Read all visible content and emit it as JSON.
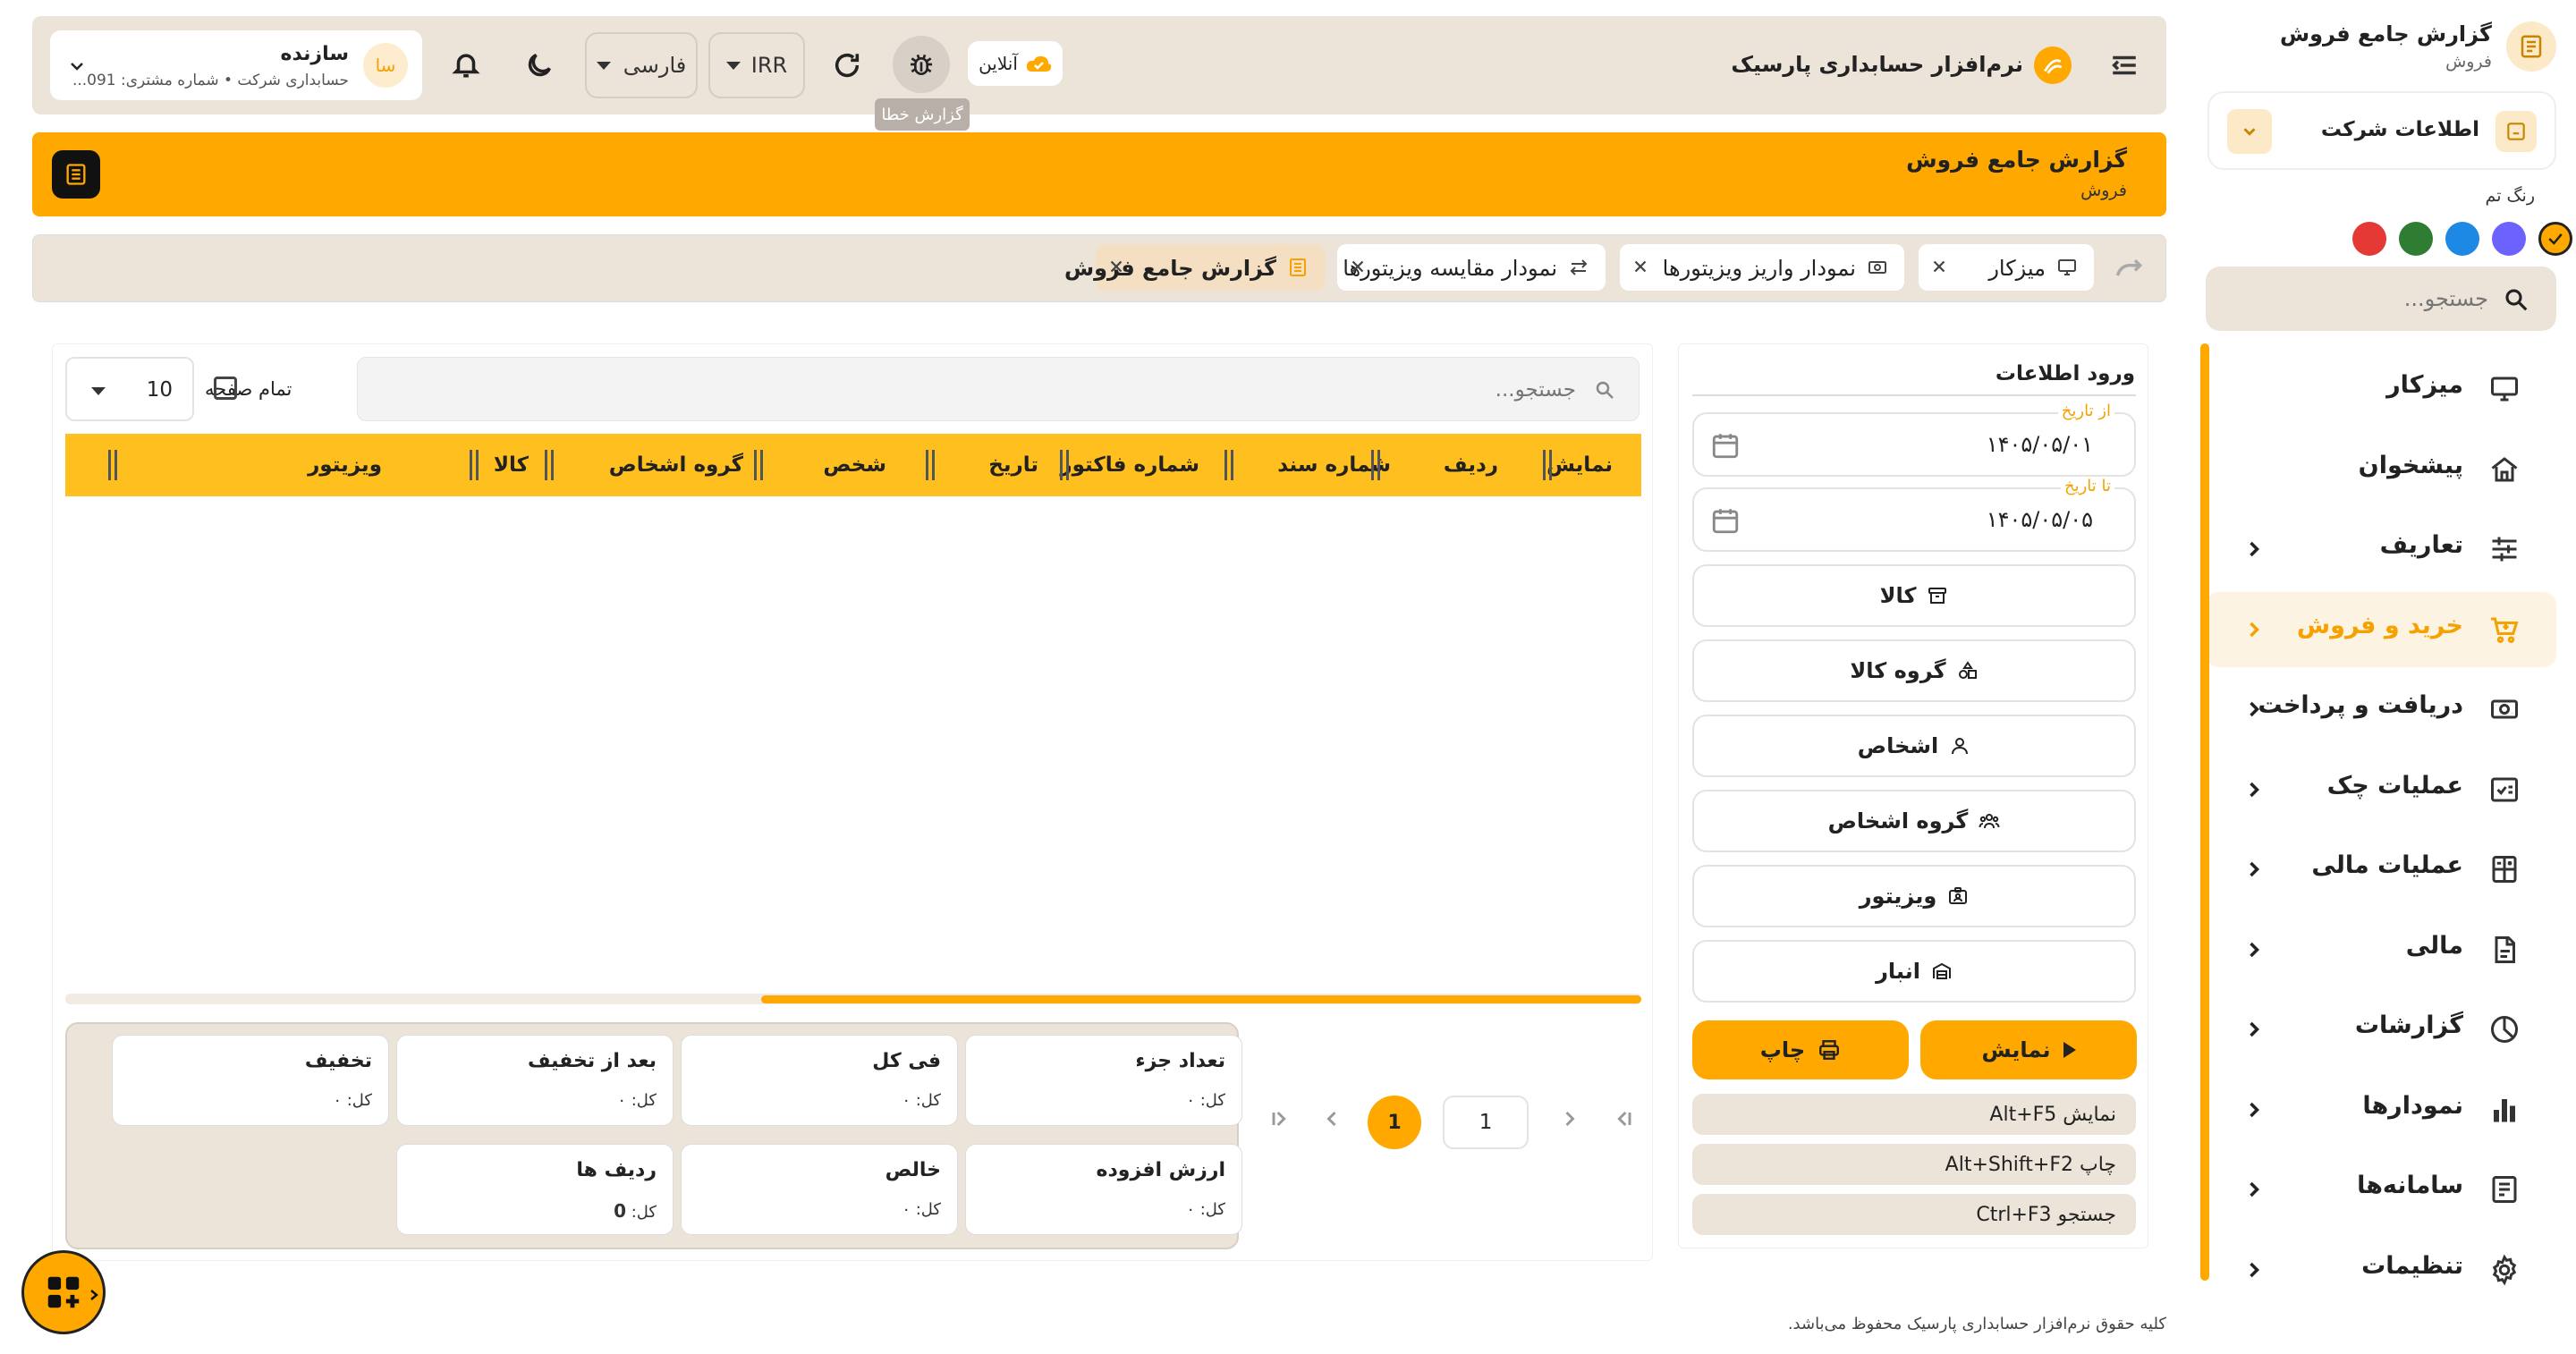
{
  "sidebar": {
    "page_title": "گزارش جامع فروش",
    "page_subtitle": "فروش",
    "company_info_label": "اطلاعات شرکت",
    "theme_color_label": "رنگ تم",
    "theme_colors": [
      "#ffa800",
      "#6c63ff",
      "#1e88e5",
      "#2e7d32",
      "#e53935"
    ],
    "search_placeholder": "جستجو...",
    "menu": [
      {
        "label": "میزکار",
        "icon": "monitor-icon",
        "chevron": false,
        "active": false
      },
      {
        "label": "پیشخوان",
        "icon": "home-icon",
        "chevron": false,
        "active": false
      },
      {
        "label": "تعاریف",
        "icon": "sliders-icon",
        "chevron": true,
        "active": false
      },
      {
        "label": "خرید و فروش",
        "icon": "cart-icon",
        "chevron": true,
        "active": true
      },
      {
        "label": "دریافت و پرداخت",
        "icon": "cash-icon",
        "chevron": true,
        "active": false
      },
      {
        "label": "عملیات چک",
        "icon": "check-document-icon",
        "chevron": true,
        "active": false
      },
      {
        "label": "عملیات مالی",
        "icon": "calculator-icon",
        "chevron": true,
        "active": false
      },
      {
        "label": "مالی",
        "icon": "file-icon",
        "chevron": true,
        "active": false
      },
      {
        "label": "گزارشات",
        "icon": "pie-chart-icon",
        "chevron": true,
        "active": false
      },
      {
        "label": "نمودارها",
        "icon": "bar-chart-icon",
        "chevron": true,
        "active": false
      },
      {
        "label": "سامانه‌ها",
        "icon": "system-icon",
        "chevron": true,
        "active": false
      },
      {
        "label": "تنظیمات",
        "icon": "gear-icon",
        "chevron": true,
        "active": false
      }
    ]
  },
  "header": {
    "app_name": "نرم‌افزار حسابداری پارسیک",
    "online_label": "آنلاین",
    "bug_tooltip": "گزارش خطا",
    "currency": "IRR",
    "language": "فارسی",
    "user_name": "سازنده",
    "user_sub": "حسابداری شرکت • شماره مشتری: 091...",
    "avatar_initials": "سا"
  },
  "titlebar": {
    "title": "گزارش جامع فروش",
    "subtitle": "فروش"
  },
  "tabs": [
    {
      "label": "میزکار",
      "icon": "monitor-icon",
      "active": false
    },
    {
      "label": "نمودار واریز ویزیتورها",
      "icon": "cash-icon",
      "active": false
    },
    {
      "label": "نمودار مقایسه ویزیتورها",
      "icon": "compare-icon",
      "active": false
    },
    {
      "label": "گزارش جامع فروش",
      "icon": "report-icon",
      "active": true
    }
  ],
  "form": {
    "title": "ورود اطلاعات",
    "from_date_label": "از تاریخ",
    "from_date": "۱۴۰۵/۰۵/۰۱",
    "to_date_label": "تا تاریخ",
    "to_date": "۱۴۰۵/۰۵/۰۵",
    "buttons": [
      {
        "label": "کالا",
        "icon": "box-icon"
      },
      {
        "label": "گروه کالا",
        "icon": "shapes-icon"
      },
      {
        "label": "اشخاص",
        "icon": "person-icon"
      },
      {
        "label": "گروه اشخاص",
        "icon": "group-icon"
      },
      {
        "label": "ویزیتور",
        "icon": "id-card-icon"
      },
      {
        "label": "انبار",
        "icon": "warehouse-icon"
      }
    ],
    "show_label": "نمایش",
    "print_label": "چاپ",
    "shortcuts": [
      "نمایش Alt+F5",
      "چاپ Alt+Shift+F2",
      "جستجو Ctrl+F3"
    ]
  },
  "table": {
    "search_placeholder": "جستجو...",
    "all_pages_label": "تمام صفحه",
    "page_size": "10",
    "columns": [
      "نمایش",
      "ردیف",
      "شماره سند",
      "شماره فاکتور",
      "تاریخ",
      "شخص",
      "گروه اشخاص",
      "کالا",
      "ویزیتور"
    ],
    "rows": [],
    "pagination": {
      "current_page": "1",
      "page_input": "1"
    }
  },
  "summary": [
    {
      "title": "تعداد جزء",
      "value": "کل: ۰"
    },
    {
      "title": "فی کل",
      "value": "کل: ۰"
    },
    {
      "title": "بعد از تخفیف",
      "value": "کل: ۰"
    },
    {
      "title": "تخفیف",
      "value": "کل: ۰"
    },
    {
      "title": "ارزش افزوده",
      "value": "کل: ۰"
    },
    {
      "title": "خالص",
      "value": "کل: ۰"
    },
    {
      "title": "ردیف ها",
      "value_prefix": "کل:",
      "value_strong": "0"
    }
  ],
  "footer": {
    "copyright": "کلیه حقوق نرم‌افزار حسابداری پارسیک محفوظ می‌باشد."
  },
  "colors": {
    "accent": "#ffa800",
    "header_bg": "#ece3d9",
    "active_tab_bg": "#f4dfc2"
  }
}
